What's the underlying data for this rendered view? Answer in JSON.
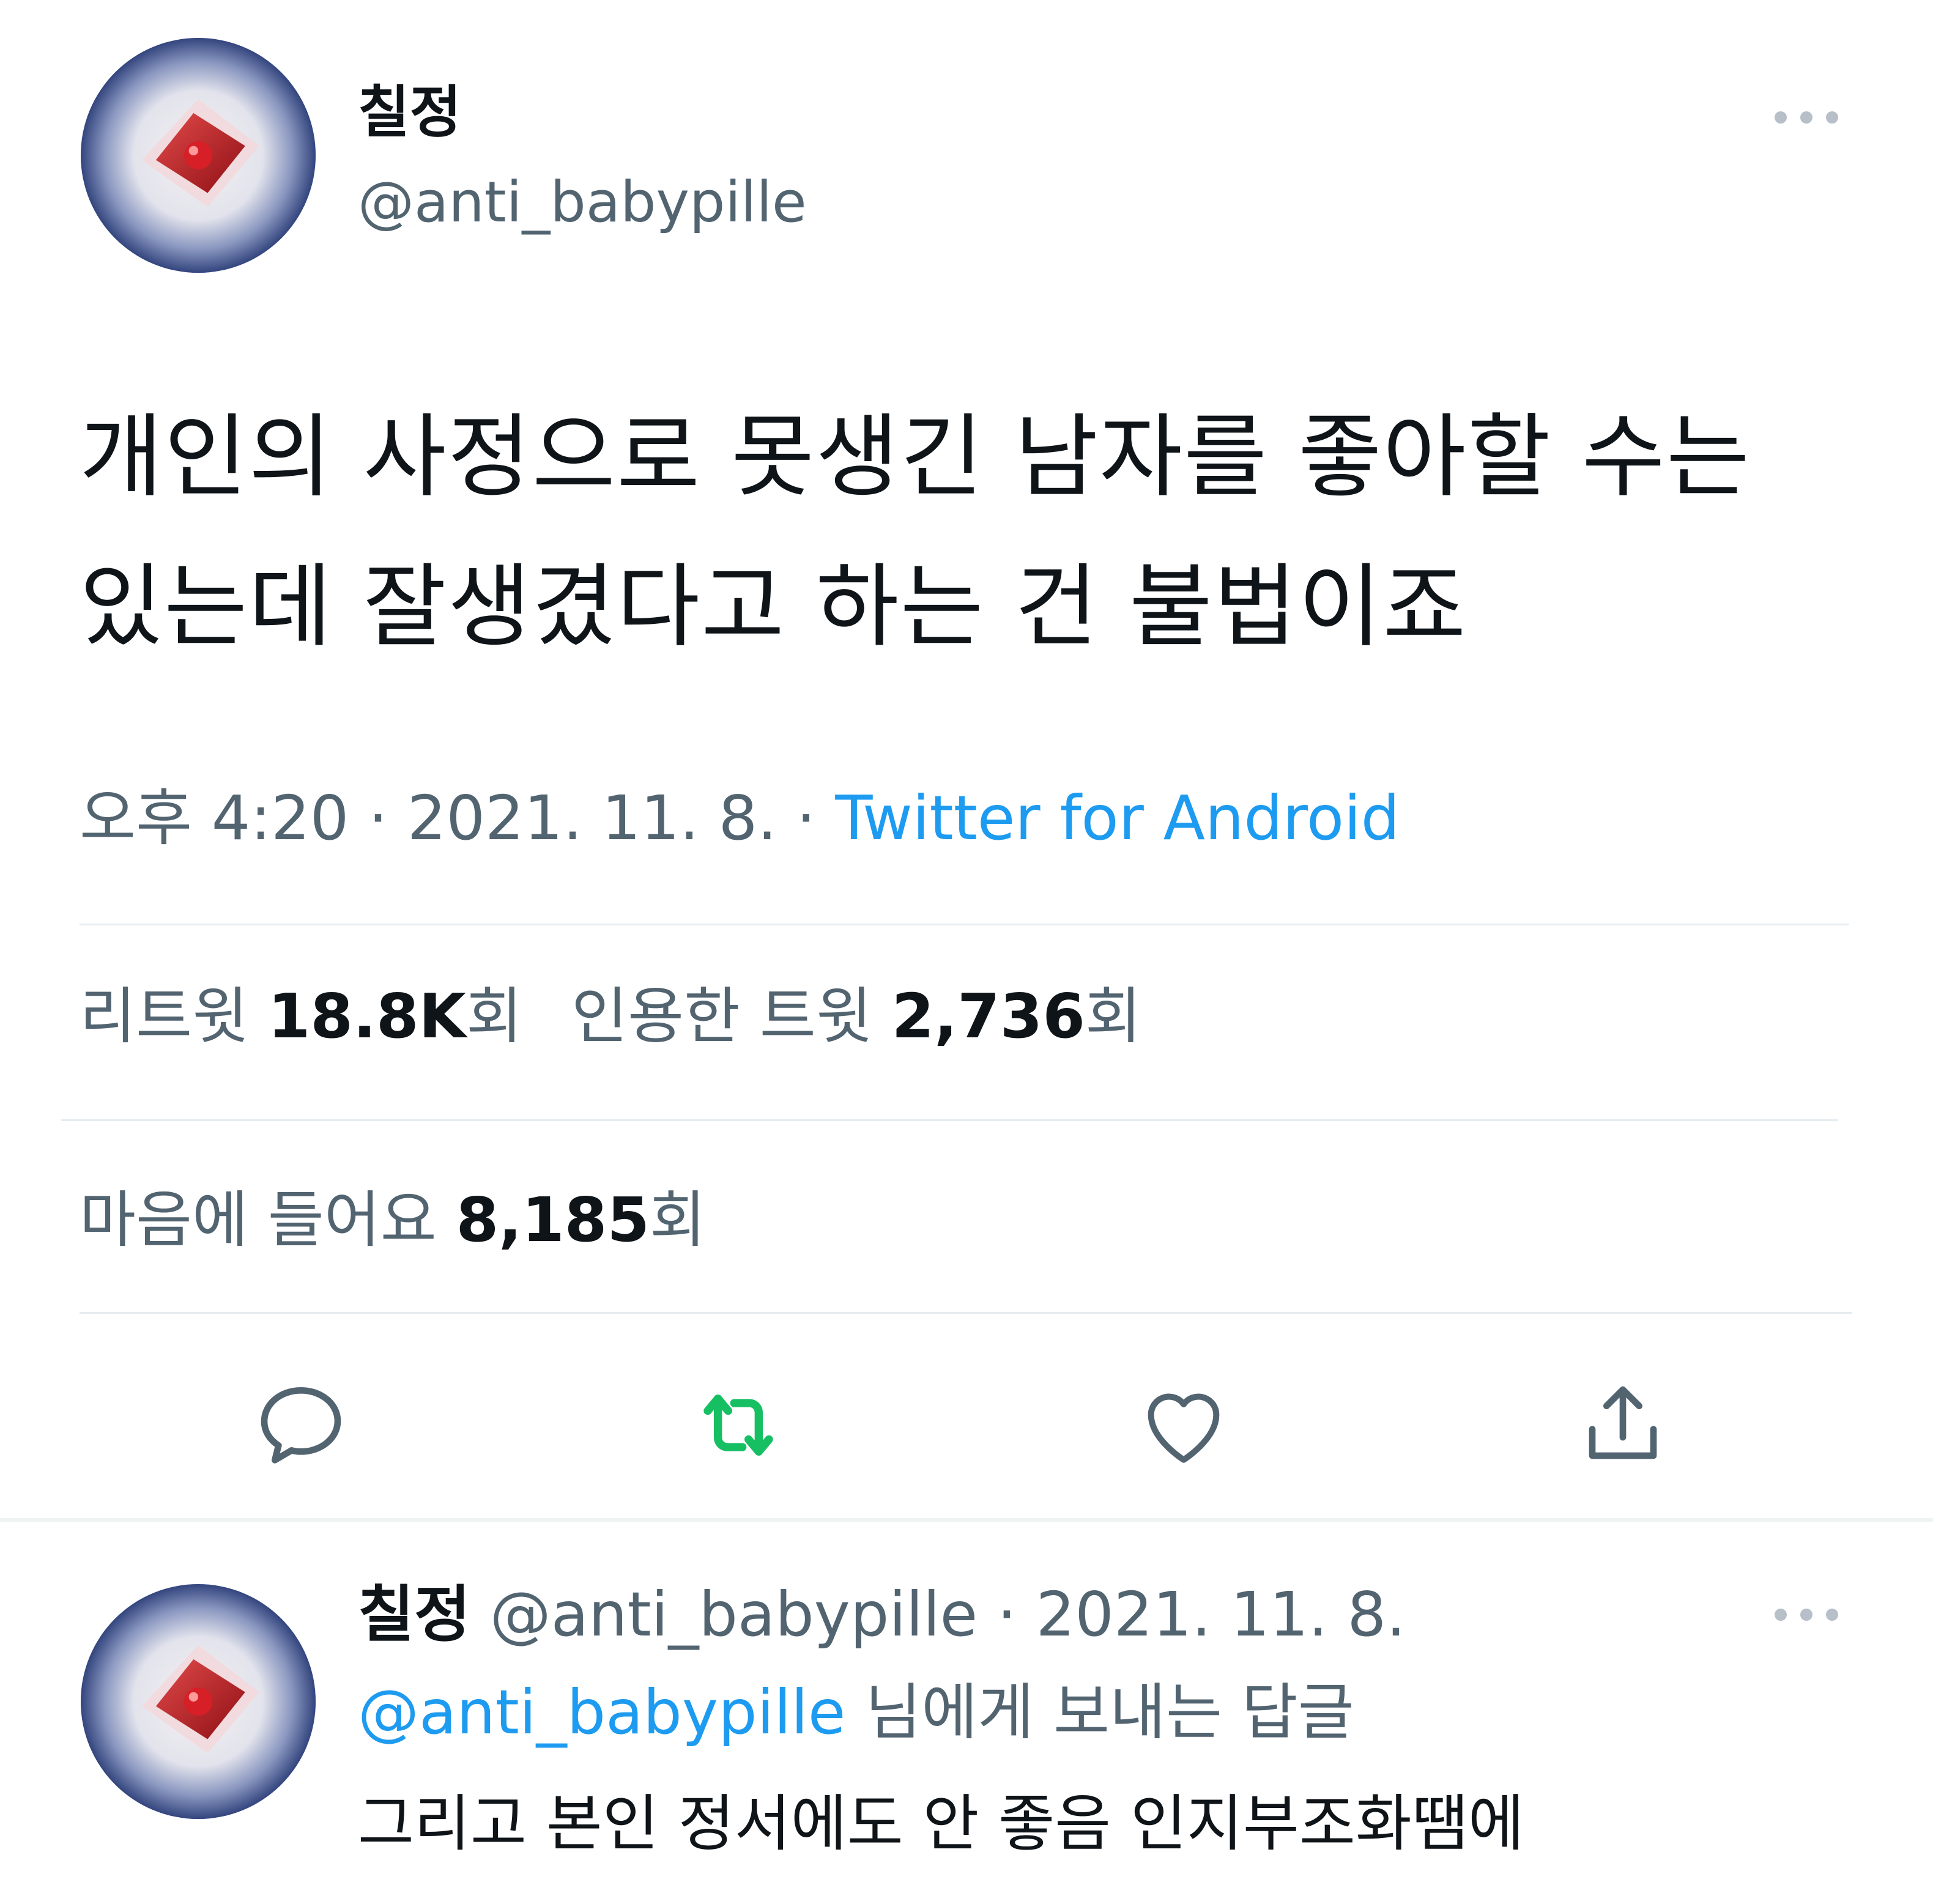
{
  "tweet": {
    "author": {
      "display_name": "칠정",
      "handle": "@anti_babypille"
    },
    "text_line1": "개인의 사정으로 못생긴 남자를 좋아할 수는",
    "text_line2": "있는데 잘생겼다고 하는 건 불법이죠",
    "time": "오후 4:20",
    "separator": " · ",
    "date": "2021. 11. 8.",
    "source": "Twitter for Android",
    "stats": {
      "retweets_label": "리트윗",
      "retweets_value": "18.8K",
      "retweets_suffix": "회",
      "quotes_label": "인용한 트윗",
      "quotes_value": "2,736",
      "quotes_suffix": "회",
      "likes_label": "마음에 들어요",
      "likes_value": "8,185",
      "likes_suffix": "회"
    },
    "actions": {
      "reply_icon": "reply-icon",
      "retweet_icon": "retweet-icon",
      "like_icon": "heart-icon",
      "share_icon": "share-icon",
      "retweet_color": "#17bf63"
    }
  },
  "reply": {
    "author": {
      "display_name": "칠정",
      "handle": "@anti_babypille"
    },
    "separator": " · ",
    "date": "2021. 11. 8.",
    "replying_to_mention": "@anti_babypille",
    "replying_to_suffix": " 님에게 보내는 답글",
    "text": "그리고 본인 정서에도 안 좋음 인지부조화땜에"
  },
  "colors": {
    "link": "#1d9bf0",
    "muted": "#536471",
    "text": "#0f1419",
    "retweet_green": "#17bf63"
  }
}
